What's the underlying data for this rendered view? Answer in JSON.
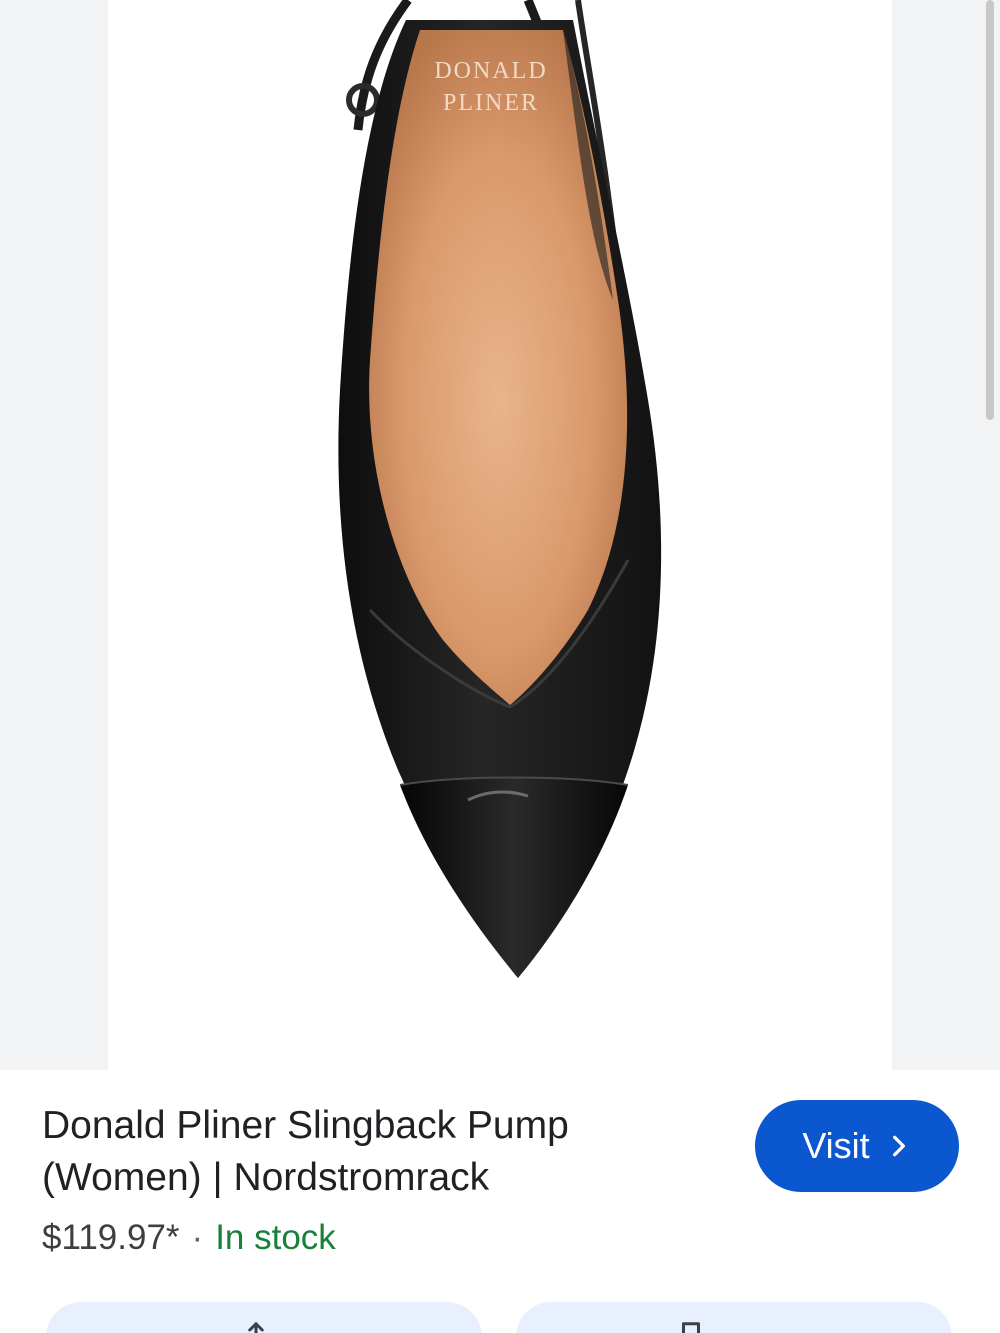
{
  "product_image": {
    "alt": "Donald Pliner Slingback Pump",
    "insole_brand_lines": [
      "DONALD",
      "PLINER"
    ]
  },
  "product": {
    "title": "Donald Pliner Slingback Pump (Women) | Nordstromrack",
    "price": "$119.97*",
    "separator": "·",
    "availability": "In stock"
  },
  "actions": {
    "visit_label": "Visit",
    "visit_icon": "chevron-right-icon",
    "share_icon": "share-icon",
    "save_icon": "bookmark-icon"
  },
  "colors": {
    "accent": "#0b57d0",
    "in_stock": "#188038",
    "pill_bg": "#e8f0fe",
    "image_backdrop": "#f1f3f4"
  }
}
